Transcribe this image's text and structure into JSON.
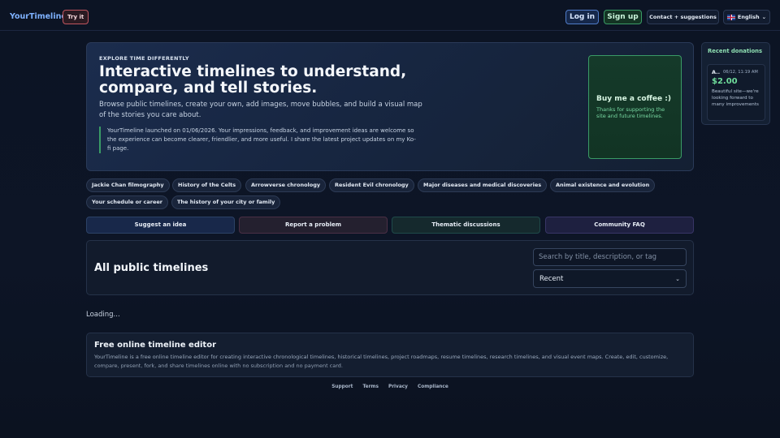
{
  "header": {
    "brand": "YourTimeline",
    "try_label": "Try it",
    "login_label": "Log in",
    "signup_label": "Sign up",
    "contact_label": "Contact + suggestions",
    "language_label": "English",
    "language_caret": "⌄"
  },
  "hero": {
    "eyebrow": "EXPLORE TIME DIFFERENTLY",
    "title": "Interactive timelines to understand, compare, and tell stories.",
    "description": "Browse public timelines, create your own, add images, move bubbles, and build a visual map of the stories you care about.",
    "note": "YourTimeline launched on 01/06/2026. Your impressions, feedback, and improvement ideas are welcome so the experience can become clearer, friendlier, and more useful. I share the latest project updates on my Ko-fi page.",
    "coffee": {
      "title": "Buy me a coffee :)",
      "subtitle": "Thanks for supporting the site and future timelines."
    }
  },
  "donations": {
    "title": "Recent donations",
    "items": [
      {
        "name": "A..",
        "date": "06/12, 11:19 AM",
        "amount": "$2.00",
        "message": "Beautiful site—we're looking forward to many improvements"
      }
    ]
  },
  "chips": [
    "Jackie Chan filmography",
    "History of the Celts",
    "Arrowverse chronology",
    "Resident Evil chronology",
    "Major diseases and medical discoveries",
    "Animal existence and evolution",
    "Your schedule or career",
    "The history of your city or family"
  ],
  "actions": [
    "Suggest an idea",
    "Report a problem",
    "Thematic discussions",
    "Community FAQ"
  ],
  "public": {
    "title": "All public timelines",
    "search_placeholder": "Search by title, description, or tag",
    "sort_value": "Recent",
    "sort_caret": "⌄"
  },
  "loading_text": "Loading...",
  "editor": {
    "title": "Free online timeline editor",
    "text": "YourTimeline is a free online timeline editor for creating interactive chronological timelines, historical timelines, project roadmaps, resume timelines, research timelines, and visual event maps. Create, edit, customize, compare, present, fork, and share timelines online with no subscription and no payment card."
  },
  "footer": [
    "Support",
    "Terms",
    "Privacy",
    "Compliance"
  ],
  "colors": {
    "background": "#0d1526",
    "accent_blue": "#7fb2ff",
    "accent_green": "#3a9b66",
    "accent_red": "#c0555f"
  }
}
